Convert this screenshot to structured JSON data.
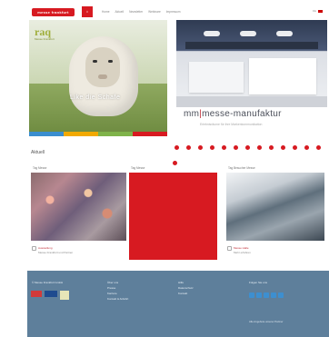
{
  "header": {
    "logo_text": "messe frankfurt",
    "home_label": "⌂",
    "nav": [
      "Home",
      "Aktuell",
      "Newsletter",
      "Webinare",
      "Impressum"
    ],
    "lang_label": "DE"
  },
  "hero_left": {
    "brand": "raq",
    "brand_sub": "Messe Frankfurt",
    "caption": "Like die Schafe"
  },
  "hero_right": {
    "title_a": "mm",
    "title_sep": "|",
    "title_b": "messe-manufaktur",
    "subtitle": "Erlebnisräume für ihre Markenkommunikation"
  },
  "news": {
    "heading": "Aktuell",
    "items": [
      {
        "label": "Tag Messe",
        "meta_title": "Ausstellung",
        "meta_line": "Messe Frankfurt und Partner"
      },
      {
        "label": "Tag Messe",
        "meta_title": "",
        "meta_line": ""
      },
      {
        "label": "Tag Besucher Messe",
        "meta_title": "Messe Halle",
        "meta_line": "Mehr erfahren"
      }
    ]
  },
  "footer": {
    "col1": [
      "© Messe Frankfurt GmbH"
    ],
    "col2": [
      "Über uns",
      "Presse",
      "Karriere",
      "Kontakt & Anfahrt"
    ],
    "col3": [
      "Hilfe",
      "Datenschutz",
      "Kontakt"
    ],
    "col4": [
      "Folgen Sie uns"
    ],
    "bottom": "Alle Angebote unserer Partner"
  },
  "colors": {
    "accent": "#d71a21",
    "footer": "#5e7f9b"
  }
}
